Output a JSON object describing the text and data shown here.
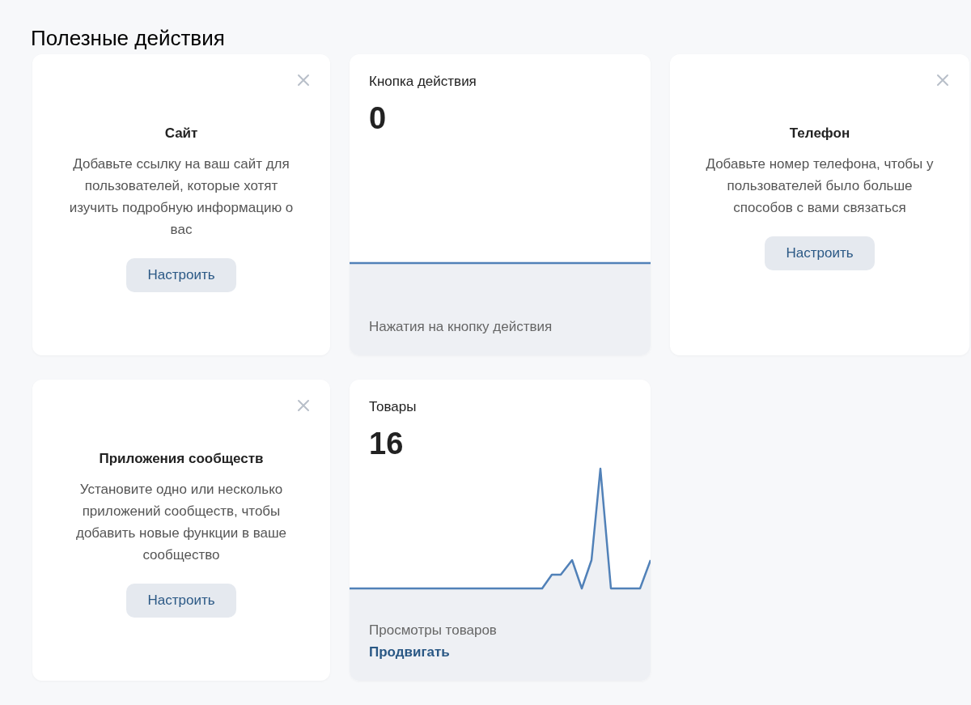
{
  "title": "Полезные действия",
  "cards": [
    {
      "kind": "promo",
      "title": "Сайт",
      "text": "Добавьте ссылку на ваш сайт для пользователей, которые хотят изучить подробную информацию о вас",
      "button": "Настроить"
    },
    {
      "kind": "stat",
      "title": "Кнопка действия",
      "value": "0",
      "caption": "Нажатия на кнопку действия"
    },
    {
      "kind": "promo",
      "title": "Телефон",
      "text": "Добавьте номер телефона, чтобы у пользователей было больше способов с вами связаться",
      "button": "Настроить"
    },
    {
      "kind": "promo",
      "title": "Приложения сообществ",
      "text": "Установите одно или несколько приложений сообществ, чтобы добавить новые функции в ваше сообщество",
      "button": "Настроить"
    },
    {
      "kind": "stat",
      "title": "Товары",
      "value": "16",
      "caption": "Просмотры товаров",
      "link": "Продвигать"
    }
  ]
}
